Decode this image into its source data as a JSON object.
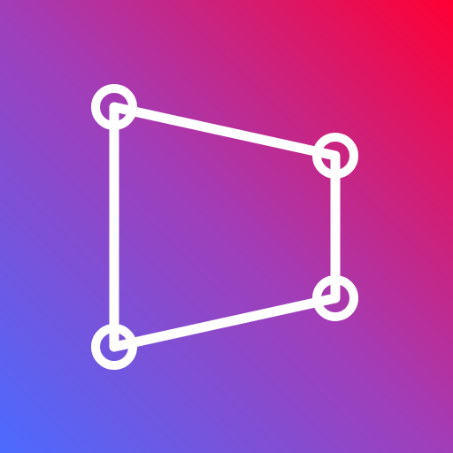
{
  "app_icon": {
    "icon_name": "perspective-crop-icon",
    "colors": {
      "gradient_start": "#4B6BFF",
      "gradient_mid": "#A23DB8",
      "gradient_end": "#FF0033",
      "glyph": "#FFFFFF"
    }
  }
}
